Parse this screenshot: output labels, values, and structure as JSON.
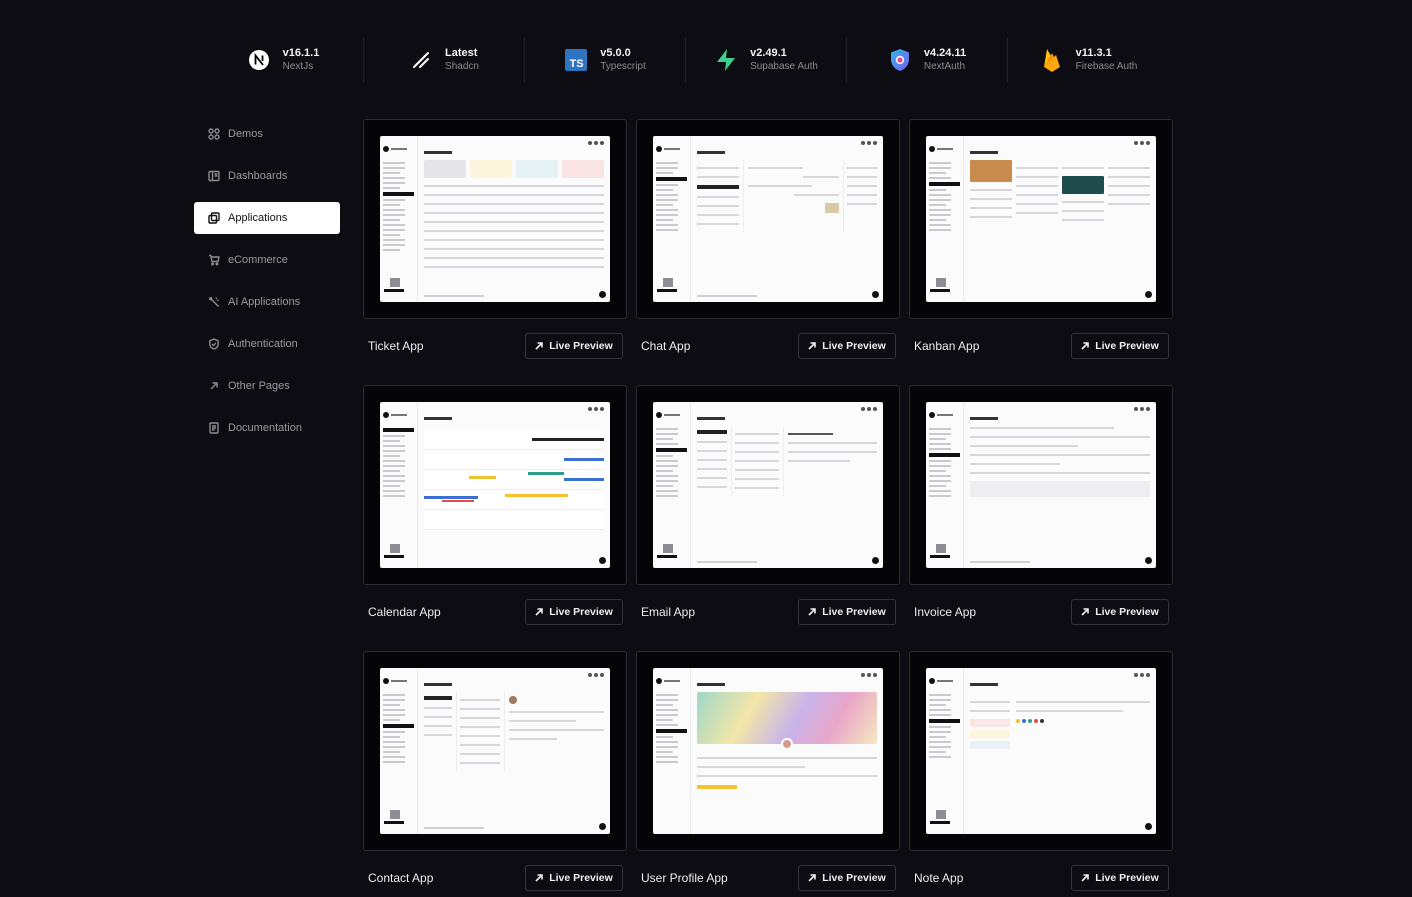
{
  "tech_stack": [
    {
      "version": "v16.1.1",
      "name": "NextJs",
      "icon": "nextjs-logo-icon"
    },
    {
      "version": "Latest",
      "name": "Shadcn",
      "icon": "shadcn-logo-icon"
    },
    {
      "version": "v5.0.0",
      "name": "Typescript",
      "icon": "typescript-logo-icon"
    },
    {
      "version": "v2.49.1",
      "name": "Supabase Auth",
      "icon": "supabase-logo-icon"
    },
    {
      "version": "v4.24.11",
      "name": "NextAuth",
      "icon": "nextauth-logo-icon"
    },
    {
      "version": "v11.3.1",
      "name": "Firebase Auth",
      "icon": "firebase-logo-icon"
    }
  ],
  "sidebar": {
    "items": [
      {
        "label": "Demos",
        "icon": "grid-icon",
        "active": false
      },
      {
        "label": "Dashboards",
        "icon": "dashboard-icon",
        "active": false
      },
      {
        "label": "Applications",
        "icon": "applications-icon",
        "active": true
      },
      {
        "label": "eCommerce",
        "icon": "cart-icon",
        "active": false
      },
      {
        "label": "AI Applications",
        "icon": "ai-icon",
        "active": false
      },
      {
        "label": "Authentication",
        "icon": "shield-icon",
        "active": false
      },
      {
        "label": "Other Pages",
        "icon": "arrow-up-right-icon",
        "active": false
      },
      {
        "label": "Documentation",
        "icon": "document-icon",
        "active": false
      }
    ]
  },
  "apps": [
    {
      "title": "Ticket App",
      "preview_label": "Live Preview"
    },
    {
      "title": "Chat App",
      "preview_label": "Live Preview"
    },
    {
      "title": "Kanban App",
      "preview_label": "Live Preview"
    },
    {
      "title": "Calendar App",
      "preview_label": "Live Preview"
    },
    {
      "title": "Email App",
      "preview_label": "Live Preview"
    },
    {
      "title": "Invoice App",
      "preview_label": "Live Preview"
    },
    {
      "title": "Contact App",
      "preview_label": "Live Preview"
    },
    {
      "title": "User Profile App",
      "preview_label": "Live Preview"
    },
    {
      "title": "Note App",
      "preview_label": "Live Preview"
    }
  ],
  "colors": {
    "background": "#0c0c12",
    "active_nav_bg": "#ffffff",
    "typescript_blue": "#2f74c0",
    "supabase_green": "#3ecf8e",
    "firebase_orange": "#ffa611"
  }
}
